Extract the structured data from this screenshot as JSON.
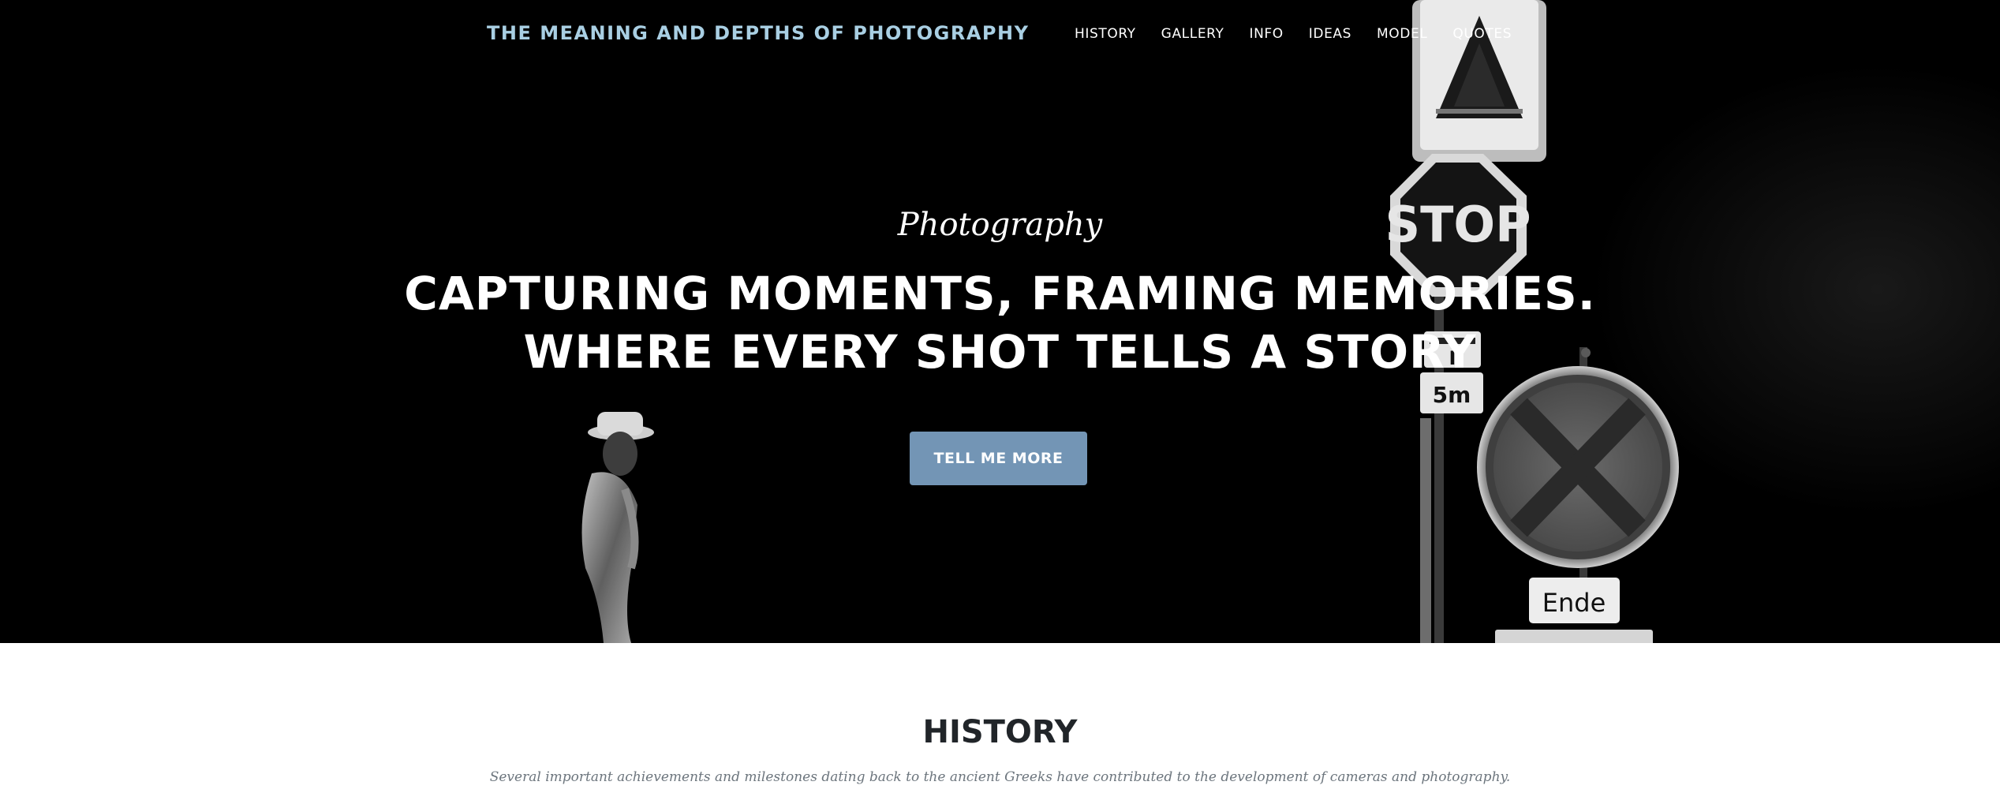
{
  "navbar": {
    "brand": "THE MEANING AND DEPTHS OF PHOTOGRAPHY",
    "items": [
      {
        "label": "HISTORY"
      },
      {
        "label": "GALLERY"
      },
      {
        "label": "INFO"
      },
      {
        "label": "IDEAS"
      },
      {
        "label": "MODEL"
      },
      {
        "label": "QUOTES"
      }
    ]
  },
  "hero": {
    "subheading": "Photography",
    "heading_line1": "Capturing moments, framing memories.",
    "heading_line2": "Where every shot tells a story",
    "button_label": "TELL ME MORE",
    "image_text": {
      "stop_sign": "STOP",
      "distance_top": "I",
      "distance_bottom": "5m",
      "end_sign": "Ende"
    }
  },
  "history": {
    "title": "HISTORY",
    "subtitle": "Several important achievements and milestones dating back to the ancient Greeks have contributed to the development of cameras and photography."
  },
  "colors": {
    "brand": "#a9cfe3",
    "button": "#7395b5",
    "hero_background": "#000000",
    "heading_text": "#212529",
    "muted_text": "#6c757d"
  }
}
